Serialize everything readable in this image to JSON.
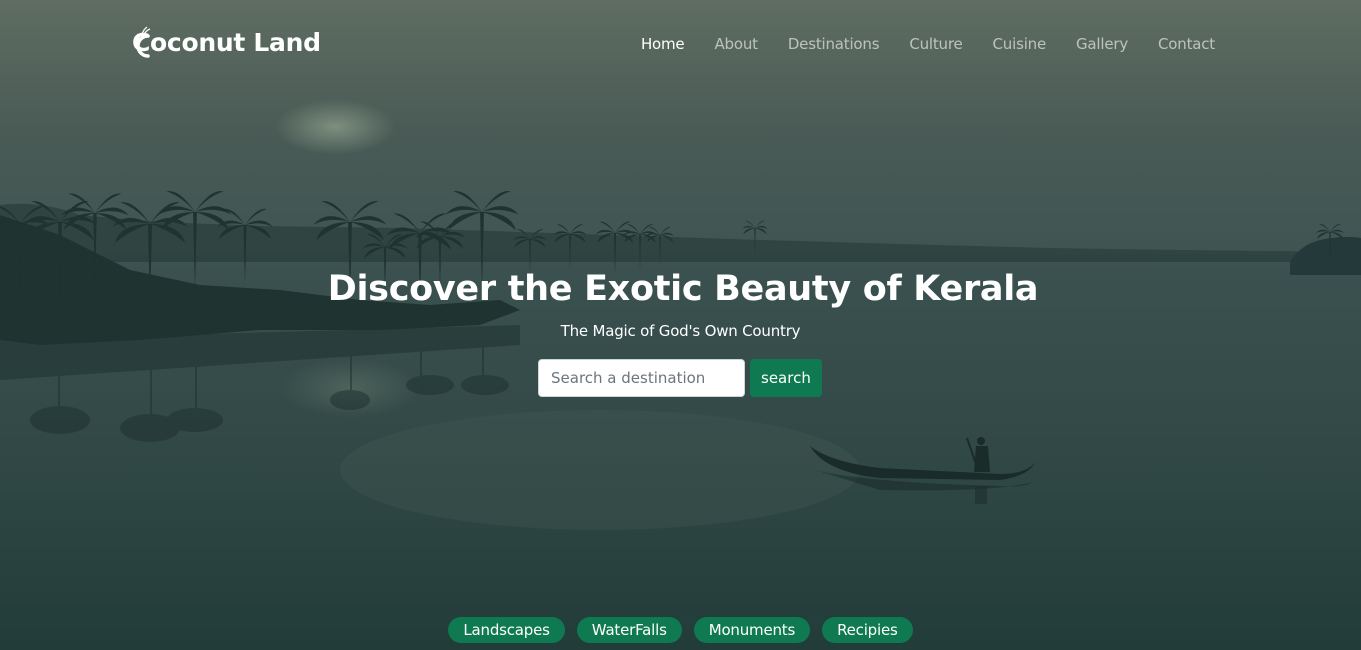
{
  "brand": {
    "name": "Coconut Land",
    "logo_icon": "coconut-c-logo-icon"
  },
  "nav": {
    "items": [
      {
        "label": "Home",
        "active": true
      },
      {
        "label": "About",
        "active": false
      },
      {
        "label": "Destinations",
        "active": false
      },
      {
        "label": "Culture",
        "active": false
      },
      {
        "label": "Cuisine",
        "active": false
      },
      {
        "label": "Gallery",
        "active": false
      },
      {
        "label": "Contact",
        "active": false
      }
    ]
  },
  "hero": {
    "title": "Discover the Exotic Beauty of Kerala",
    "subtitle": "The Magic of God's Own Country",
    "background_image": "kerala-backwater-palms-canoe"
  },
  "search": {
    "placeholder": "Search a destination",
    "value": "",
    "button_label": "search"
  },
  "categories": [
    "Landscapes",
    "WaterFalls",
    "Monuments",
    "Recipies"
  ],
  "colors": {
    "accent": "#0f7a52",
    "text": "#ffffff",
    "nav_inactive": "rgba(255,255,255,0.6)"
  }
}
